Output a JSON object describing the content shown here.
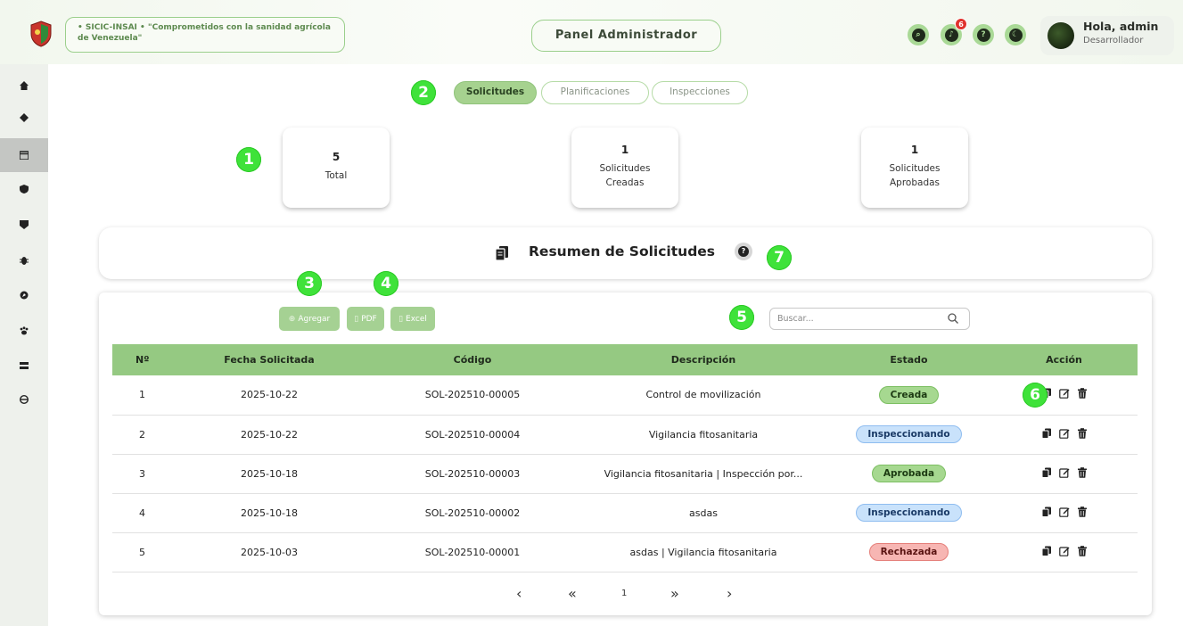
{
  "header": {
    "slogan": "• SICIC-INSAI • \"Comprometidos con la sanidad agrícola de Venezuela\"",
    "panel_label": "Panel Administrador",
    "notifications_count": "6",
    "user_greeting": "Hola, admin",
    "user_role": "Desarrollador",
    "icons": [
      "search-icon",
      "bell-icon",
      "help-icon",
      "moon-icon"
    ]
  },
  "sidebar": {
    "items": [
      "home",
      "leaf",
      "calendar",
      "shield",
      "clipboard",
      "bug",
      "compass",
      "paw",
      "truck",
      "user"
    ],
    "active": "calendar"
  },
  "tabs": [
    {
      "label": "Solicitudes",
      "active": true
    },
    {
      "label": "Planificaciones",
      "active": false
    },
    {
      "label": "Inspecciones",
      "active": false
    }
  ],
  "stats": [
    {
      "value": "5",
      "label": "Total"
    },
    {
      "value": "1",
      "label": "Solicitudes Creadas"
    },
    {
      "value": "1",
      "label": "Solicitudes Aprobadas"
    }
  ],
  "summary": {
    "title": "Resumen de Solicitudes"
  },
  "toolbar": {
    "add_label": "Agregar",
    "pdf_label": "PDF",
    "excel_label": "Excel",
    "search_placeholder": "Buscar..."
  },
  "callouts": [
    "1",
    "2",
    "3",
    "4",
    "5",
    "6",
    "7"
  ],
  "table": {
    "columns": [
      "Nº",
      "Fecha Solicitada",
      "Código",
      "Descripción",
      "Estado",
      "Acción"
    ],
    "rows": [
      {
        "n": "1",
        "fecha": "2025-10-22",
        "codigo": "SOL-202510-00005",
        "descripcion": "Control de movilización",
        "estado": "Creada"
      },
      {
        "n": "2",
        "fecha": "2025-10-22",
        "codigo": "SOL-202510-00004",
        "descripcion": "Vigilancia fitosanitaria",
        "estado": "Inspeccionando"
      },
      {
        "n": "3",
        "fecha": "2025-10-18",
        "codigo": "SOL-202510-00003",
        "descripcion": "Vigilancia fitosanitaria | Inspección por...",
        "estado": "Aprobada"
      },
      {
        "n": "4",
        "fecha": "2025-10-18",
        "codigo": "SOL-202510-00002",
        "descripcion": "asdas",
        "estado": "Inspeccionando"
      },
      {
        "n": "5",
        "fecha": "2025-10-03",
        "codigo": "SOL-202510-00001",
        "descripcion": "asdas | Vigilancia fitosanitaria",
        "estado": "Rechazada"
      }
    ]
  },
  "estado_colors": {
    "Creada": {
      "bg": "#a6d890",
      "border": "#7cbf62",
      "text": "#1c3a12"
    },
    "Inspeccionando": {
      "bg": "#c9e2fb",
      "border": "#8fbdf0",
      "text": "#1a3a66"
    },
    "Aprobada": {
      "bg": "#a6d890",
      "border": "#7cbf62",
      "text": "#1c3a12"
    },
    "Rechazada": {
      "bg": "#f7b6b3",
      "border": "#e57f7a",
      "text": "#5a1412"
    }
  },
  "pagination": {
    "prev": "‹",
    "first": "«",
    "page": "1",
    "last": "»",
    "next": "›"
  },
  "colors": {
    "accent": "#95c982",
    "callout": "#3fe23a"
  }
}
